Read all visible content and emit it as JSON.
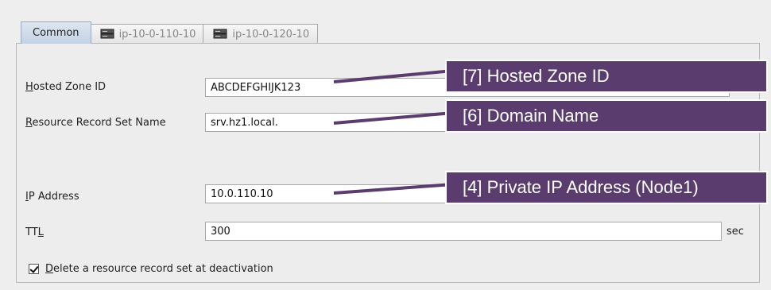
{
  "tabs": [
    {
      "label": "Common",
      "active": true
    },
    {
      "label": "ip-10-0-110-10",
      "active": false,
      "icon": "server-icon"
    },
    {
      "label": "ip-10-0-120-10",
      "active": false,
      "icon": "server-icon"
    }
  ],
  "fields": {
    "hosted_zone_id": {
      "label_mnemonic": "H",
      "label_rest": "osted Zone ID",
      "value": "ABCDEFGHIJK123"
    },
    "record_set_name": {
      "label_mnemonic": "R",
      "label_rest": "esource Record Set Name",
      "value": "srv.hz1.local."
    },
    "ip_address": {
      "label_mnemonic": "I",
      "label_rest": "P Address",
      "value": "10.0.110.10"
    },
    "ttl": {
      "label_prefix": "TT",
      "label_mnemonic": "L",
      "value": "300",
      "unit": "sec"
    }
  },
  "delete_checkbox": {
    "checked": true,
    "label_mnemonic": "D",
    "label_rest": "elete a resource record set at deactivation"
  },
  "callouts": {
    "hosted_zone": "[7] Hosted Zone ID",
    "domain_name": "[6] Domain Name",
    "private_ip": "[4] Private IP Address (Node1)"
  },
  "colors": {
    "callout_bg": "#5a3d6e",
    "arrow": "#5a3d6e",
    "active_tab": "#c3d2e4"
  }
}
